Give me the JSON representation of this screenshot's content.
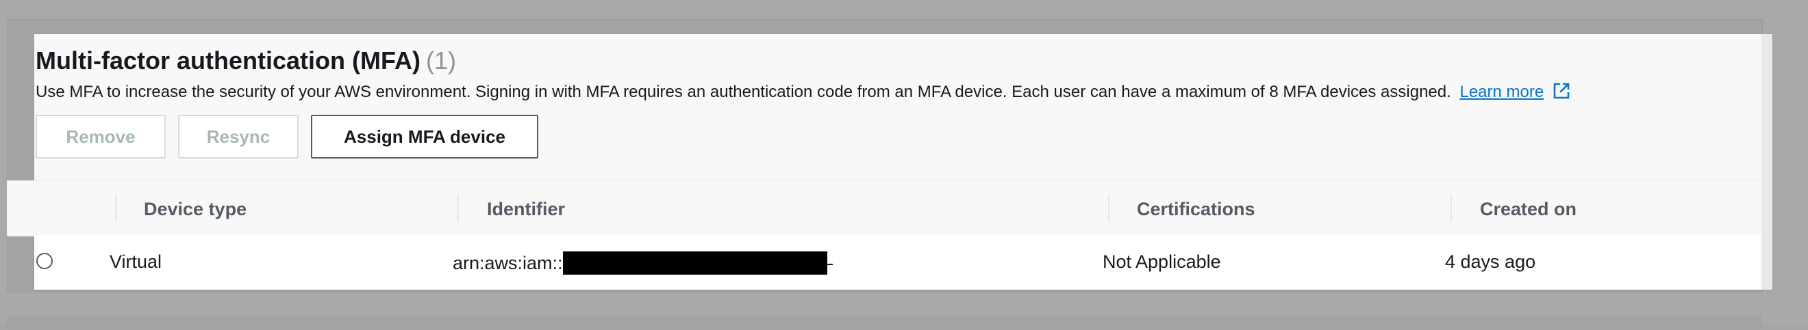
{
  "panel": {
    "title": "Multi-factor authentication (MFA)",
    "count": "(1)",
    "description": "Use MFA to increase the security of your AWS environment. Signing in with MFA requires an authentication code from an MFA device. Each user can have a maximum of 8 MFA devices assigned.",
    "learn_more": "Learn more"
  },
  "buttons": {
    "remove": "Remove",
    "resync": "Resync",
    "assign": "Assign MFA device"
  },
  "table": {
    "columns": [
      "Device type",
      "Identifier",
      "Certifications",
      "Created on"
    ],
    "rows": [
      {
        "device_type": "Virtual",
        "identifier_prefix": "arn:aws:iam::",
        "certifications": "Not Applicable",
        "created_on": "4 days ago"
      }
    ]
  },
  "colors": {
    "link": "#0972d3",
    "text": "#16191f",
    "muted": "#879596",
    "disabled": "#aab7b8"
  },
  "icons": {
    "external_link": "external-link-icon",
    "radio": "radio-unselected"
  }
}
